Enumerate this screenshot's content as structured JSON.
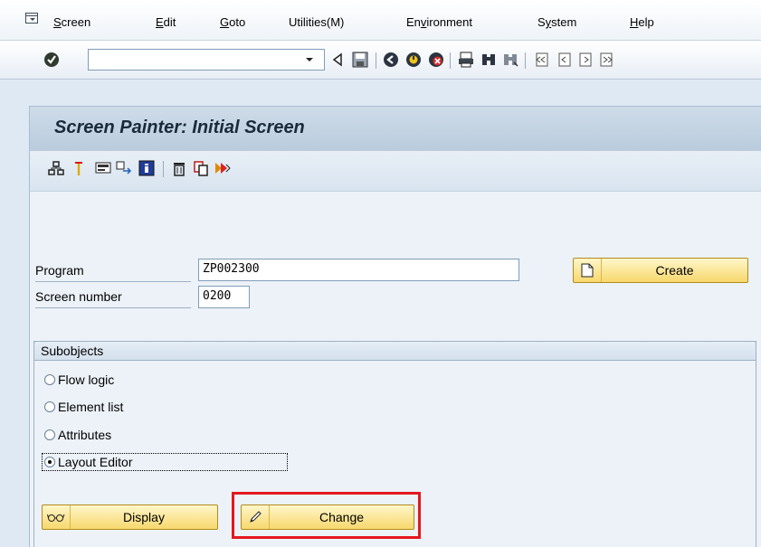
{
  "menu": {
    "items": [
      {
        "label_ul": "S",
        "label_rest": "creen"
      },
      {
        "label_ul": "E",
        "label_rest": "dit"
      },
      {
        "label_ul": "G",
        "label_rest": "oto"
      },
      {
        "label_full": "Utilities(M)"
      },
      {
        "label_pre": "En",
        "label_ul": "v",
        "label_rest": "ironment"
      },
      {
        "label_pre": "S",
        "label_ul": "y",
        "label_rest": "stem"
      },
      {
        "label_ul": "H",
        "label_rest": "elp"
      }
    ]
  },
  "toolbar": {
    "command_value": "",
    "icons": [
      "enter-icon",
      "back-arrow-icon",
      "save-icon",
      "back-icon",
      "exit-icon",
      "cancel-icon",
      "print-icon",
      "find-icon",
      "find-next-icon",
      "first-page-icon",
      "previous-page-icon",
      "next-page-icon"
    ]
  },
  "title": "Screen Painter: Initial Screen",
  "app_toolbar": {
    "icons": [
      "other-object-icon",
      "check-icon",
      "layout-icon",
      "where-used-icon",
      "info-icon",
      "delete-icon",
      "copy-icon",
      "test-icon"
    ]
  },
  "form": {
    "program_label": "Program",
    "program_value": "ZP002300",
    "screen_label": "Screen number",
    "screen_value": "0200",
    "create_label": "Create"
  },
  "subobjects": {
    "title": "Subobjects",
    "options": [
      {
        "label": "Flow logic",
        "checked": false
      },
      {
        "label": "Element list",
        "checked": false
      },
      {
        "label": "Attributes",
        "checked": false
      },
      {
        "label": "Layout Editor",
        "checked": true
      }
    ],
    "display_label": "Display",
    "change_label": "Change"
  },
  "colors": {
    "highlight": "#e4171d",
    "button_gold": "#f7d86d",
    "title_band": "#b9cbdc"
  }
}
